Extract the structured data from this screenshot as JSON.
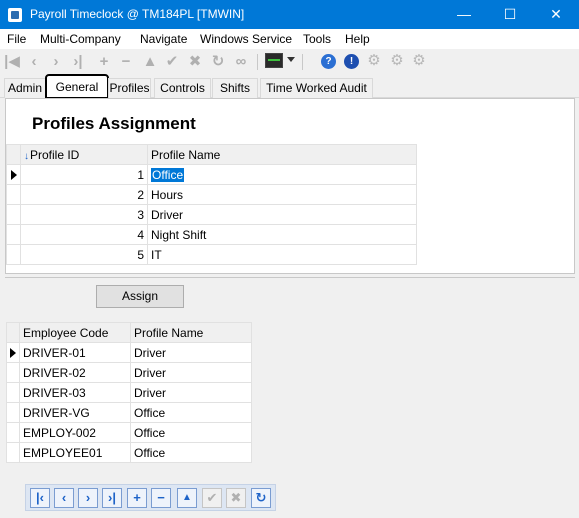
{
  "window": {
    "title": "Payroll Timeclock @ TM184PL [TMWIN]",
    "min_glyph": "—",
    "max_glyph": "☐",
    "close_glyph": "✕"
  },
  "menu": [
    "File",
    "Multi-Company",
    "Navigate",
    "Windows Service",
    "Tools",
    "Help"
  ],
  "toolbar": {
    "icons": [
      "first-icon",
      "previous-icon",
      "next-icon",
      "last-icon",
      "add-icon",
      "delete-icon",
      "up-icon",
      "save-check-icon",
      "cancel-icon",
      "refresh-icon",
      "link-icon",
      "monitor-icon",
      "help-icon",
      "info-icon",
      "gear-icon",
      "gears-icon",
      "gear-alt-icon"
    ]
  },
  "tabs": [
    "Admin",
    "General",
    "Profiles",
    "Controls",
    "Shifts",
    "Time Worked Audit"
  ],
  "active_tab": "General",
  "profiles": {
    "heading": "Profiles Assignment",
    "columns": [
      "Profile ID",
      "Profile Name"
    ],
    "rows": [
      {
        "id": "1",
        "name": "Office"
      },
      {
        "id": "2",
        "name": "Hours"
      },
      {
        "id": "3",
        "name": "Driver"
      },
      {
        "id": "4",
        "name": "Night Shift"
      },
      {
        "id": "5",
        "name": "IT"
      }
    ]
  },
  "assign_button": "Assign",
  "employees": {
    "columns": [
      "Employee Code",
      "Profile Name"
    ],
    "rows": [
      {
        "code": "DRIVER-01",
        "profile": "Driver"
      },
      {
        "code": "DRIVER-02",
        "profile": "Driver"
      },
      {
        "code": "DRIVER-03",
        "profile": "Driver"
      },
      {
        "code": "DRIVER-VG",
        "profile": "Office"
      },
      {
        "code": "EMPLOY-002",
        "profile": "Office"
      },
      {
        "code": "EMPLOYEE01",
        "profile": "Office"
      }
    ]
  },
  "colors": {
    "titlebar": "#0078d7",
    "accent": "#1e63c8",
    "selection": "#0078d7"
  }
}
